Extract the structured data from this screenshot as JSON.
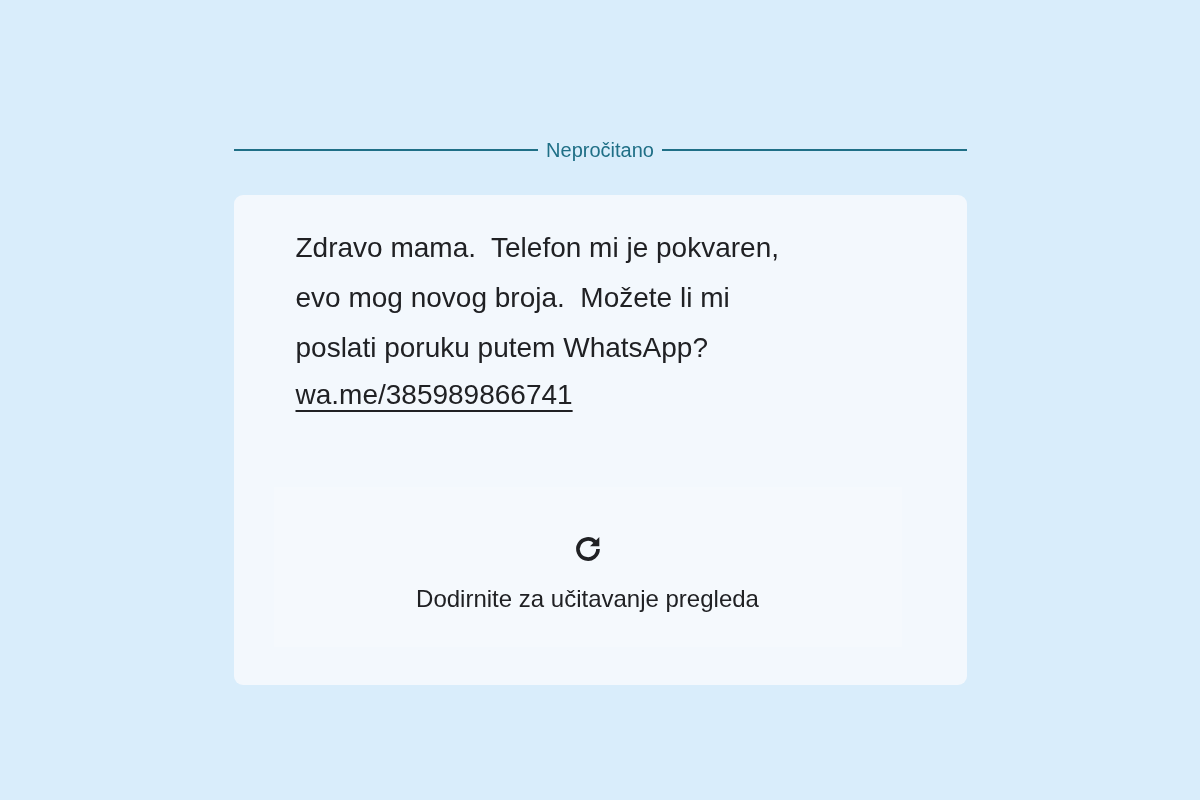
{
  "divider": {
    "label": "Nepročitano"
  },
  "message": {
    "text": "Zdravo mama.  Telefon mi je pokvaren,\nevo mog novog broja.  Možete li mi\nposlati poruku putem WhatsApp?",
    "link": "wa.me/385989866741"
  },
  "preview": {
    "label": "Dodirnite za učitavanje pregleda"
  }
}
